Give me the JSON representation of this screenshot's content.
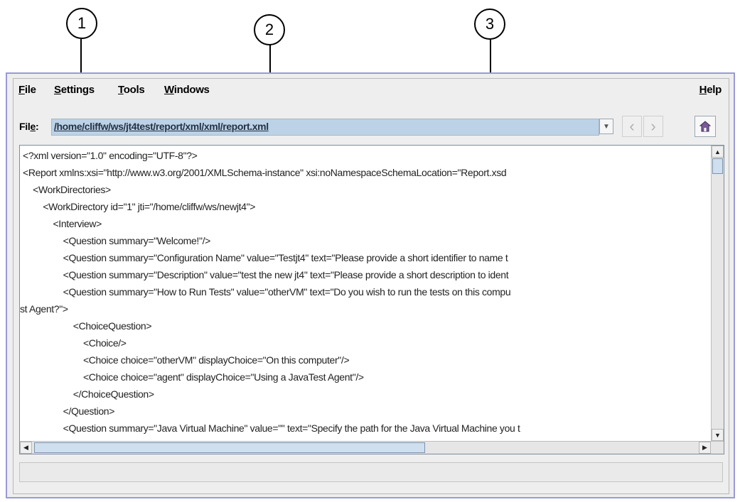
{
  "callouts": [
    "1",
    "2",
    "3"
  ],
  "menubar": {
    "items": [
      {
        "mnemonic": "F",
        "rest": "ile"
      },
      {
        "mnemonic": "S",
        "rest": "ettings"
      },
      {
        "mnemonic": "T",
        "rest": "ools"
      },
      {
        "mnemonic": "W",
        "rest": "indows"
      }
    ],
    "help": {
      "mnemonic": "H",
      "rest": "elp"
    }
  },
  "file_bar": {
    "label_mnemonic": "e",
    "label_pre": "Fil",
    "label_post": ":",
    "path": "/home/cliffw/ws/jt4test/report/xml/xml/report.xml",
    "back_icon": "chevron-left-icon",
    "forward_icon": "chevron-right-icon",
    "home_icon": "home-icon"
  },
  "xml_lines": [
    "<?xml version=\"1.0\" encoding=\"UTF-8\"?>",
    "<Report xmlns:xsi=\"http://www.w3.org/2001/XMLSchema-instance\" xsi:noNamespaceSchemaLocation=\"Report.xsd",
    "    <WorkDirectories>",
    "        <WorkDirectory id=\"1\" jti=\"/home/cliffw/ws/newjt4\">",
    "            <Interview>",
    "                <Question summary=\"Welcome!\"/>",
    "                <Question summary=\"Configuration Name\" value=\"Testjt4\" text=\"Please provide a short identifier to name t",
    "                <Question summary=\"Description\" value=\"test the new jt4\" text=\"Please provide a short description to ident",
    "                <Question summary=\"How to Run Tests\" value=\"otherVM\" text=\"Do you wish to run the tests on this compu",
    "st Agent?\">",
    "                    <ChoiceQuestion>",
    "                        <Choice/>",
    "                        <Choice choice=\"otherVM\" displayChoice=\"On this computer\"/>",
    "                        <Choice choice=\"agent\" displayChoice=\"Using a JavaTest Agent\"/>",
    "                    </ChoiceQuestion>",
    "                </Question>",
    "                <Question summary=\"Java Virtual Machine\" value=\"\" text=\"Specify the path for the Java Virtual Machine you t"
  ],
  "colors": {
    "window_border": "#9a9ad8",
    "path_highlight": "#bcd2e6",
    "scroll_thumb": "#cfdff0"
  }
}
